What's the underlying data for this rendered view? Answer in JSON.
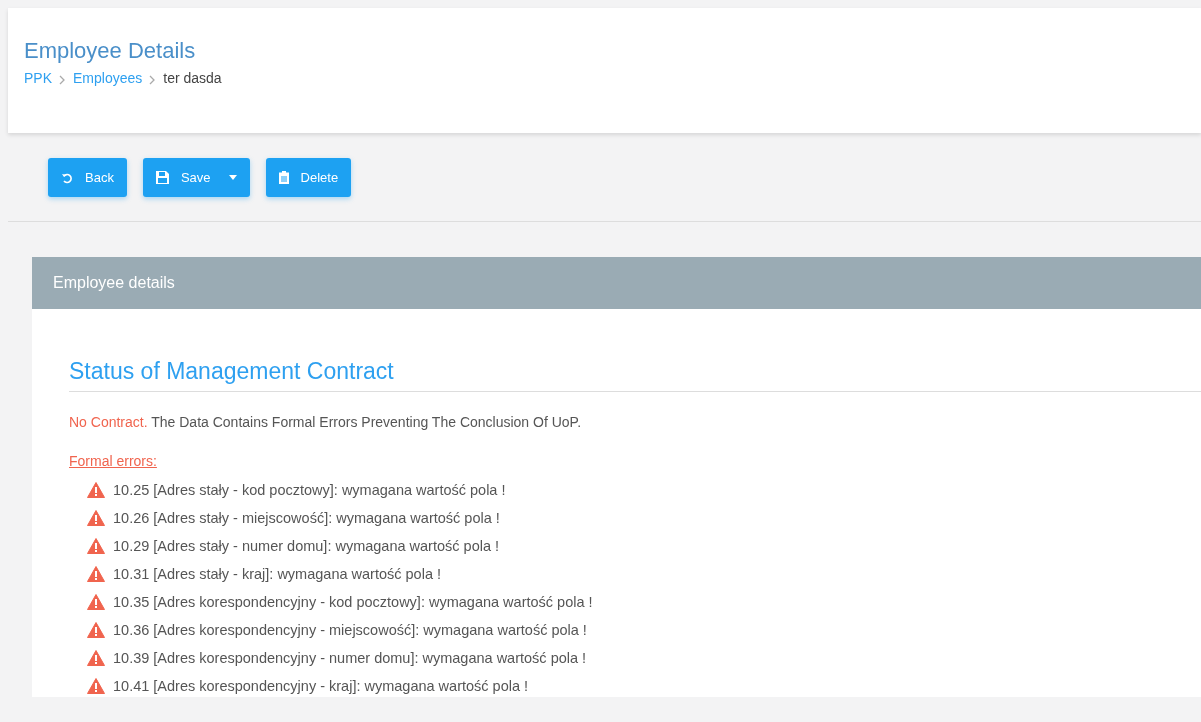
{
  "header": {
    "title": "Employee Details",
    "breadcrumb": [
      {
        "label": "PPK",
        "link": true
      },
      {
        "label": "Employees",
        "link": true
      },
      {
        "label": "ter dasda",
        "link": false
      }
    ]
  },
  "toolbar": [
    {
      "label": "Back",
      "kind": "back",
      "dropdown": false
    },
    {
      "label": "Save",
      "kind": "save",
      "dropdown": true
    },
    {
      "label": "Delete",
      "kind": "delete",
      "dropdown": false
    }
  ],
  "panel": {
    "title": "Employee details",
    "section_title": "Status of Management Contract",
    "status": "No Contract.",
    "status_message": "The Data Contains Formal Errors Preventing The Conclusion Of UoP.",
    "errors_label": "Formal errors:",
    "errors": [
      "10.25 [Adres stały - kod pocztowy]: wymagana wartość pola !",
      "10.26 [Adres stały - miejscowość]: wymagana wartość pola !",
      "10.29 [Adres stały - numer domu]: wymagana wartość pola !",
      "10.31 [Adres stały - kraj]: wymagana wartość pola !",
      "10.35 [Adres korespondencyjny - kod pocztowy]: wymagana wartość pola !",
      "10.36 [Adres korespondencyjny - miejscowość]: wymagana wartość pola !",
      "10.39 [Adres korespondencyjny - numer domu]: wymagana wartość pola !",
      "10.41 [Adres korespondencyjny - kraj]: wymagana wartość pola !"
    ]
  }
}
